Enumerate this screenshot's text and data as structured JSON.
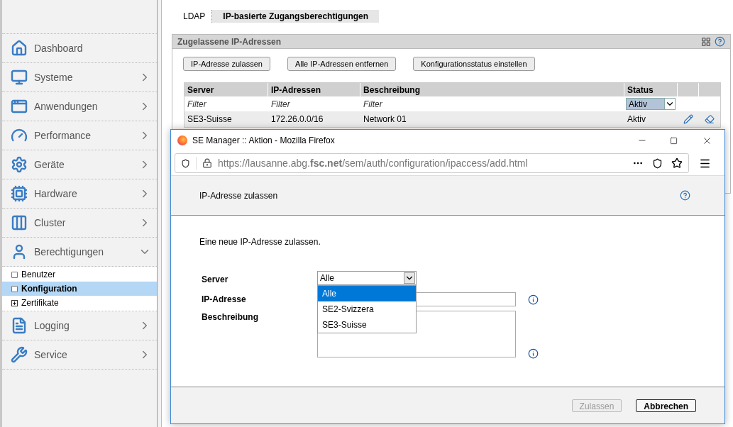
{
  "sidebar": {
    "items": [
      {
        "label": "Dashboard",
        "kind": "link"
      },
      {
        "label": "Systeme",
        "kind": "collapsed"
      },
      {
        "label": "Anwendungen",
        "kind": "collapsed"
      },
      {
        "label": "Performance",
        "kind": "collapsed"
      },
      {
        "label": "Geräte",
        "kind": "collapsed"
      },
      {
        "label": "Hardware",
        "kind": "collapsed"
      },
      {
        "label": "Cluster",
        "kind": "collapsed"
      },
      {
        "label": "Berechtigungen",
        "kind": "expanded",
        "children": [
          {
            "label": "Benutzer",
            "kind": "page",
            "selected": false
          },
          {
            "label": "Konfiguration",
            "kind": "page",
            "selected": true
          },
          {
            "label": "Zertifikate",
            "kind": "folder",
            "selected": false
          }
        ]
      },
      {
        "label": "Logging",
        "kind": "collapsed"
      },
      {
        "label": "Service",
        "kind": "collapsed"
      }
    ]
  },
  "tabs": [
    {
      "label": "LDAP",
      "selected": false
    },
    {
      "label": "IP-basierte Zugangsberechtigungen",
      "selected": true
    }
  ],
  "panel": {
    "title": "Zugelassene IP-Adressen",
    "buttons": [
      "IP-Adresse zulassen",
      "Alle IP-Adressen entfernen",
      "Konfigurationsstatus einstellen"
    ],
    "table": {
      "columns": [
        "Server",
        "IP-Adressen",
        "Beschreibung",
        "Status"
      ],
      "filters": [
        {
          "kind": "text",
          "placeholder": "Filter"
        },
        {
          "kind": "text",
          "placeholder": "Filter"
        },
        {
          "kind": "text",
          "placeholder": "Filter"
        },
        {
          "kind": "select",
          "value": "Aktiv"
        }
      ],
      "rows": [
        {
          "cells": [
            "SE3-Suisse",
            "172.26.0.0/16",
            "Network 01",
            "Aktiv"
          ]
        }
      ]
    }
  },
  "popup": {
    "title": "SE Manager :: Aktion - Mozilla Firefox",
    "url": "https://lausanne.abg.**fsc.net**/sem/auth/configuration/ipaccess/add.html",
    "heading": "IP-Adresse zulassen",
    "intro": "Eine neue IP-Adresse zulassen.",
    "server": {
      "label": "Server",
      "value": "Alle",
      "open": true,
      "options": [
        {
          "label": "Alle",
          "selected": true
        },
        {
          "label": "SE2-Svizzera",
          "selected": false
        },
        {
          "label": "SE3-Suisse",
          "selected": false
        }
      ]
    },
    "ip": {
      "label": "IP-Adresse"
    },
    "description": {
      "label": "Beschreibung"
    },
    "buttons": [
      {
        "label": "Zulassen",
        "disabled": true
      },
      {
        "label": "Abbrechen",
        "disabled": false
      }
    ]
  }
}
